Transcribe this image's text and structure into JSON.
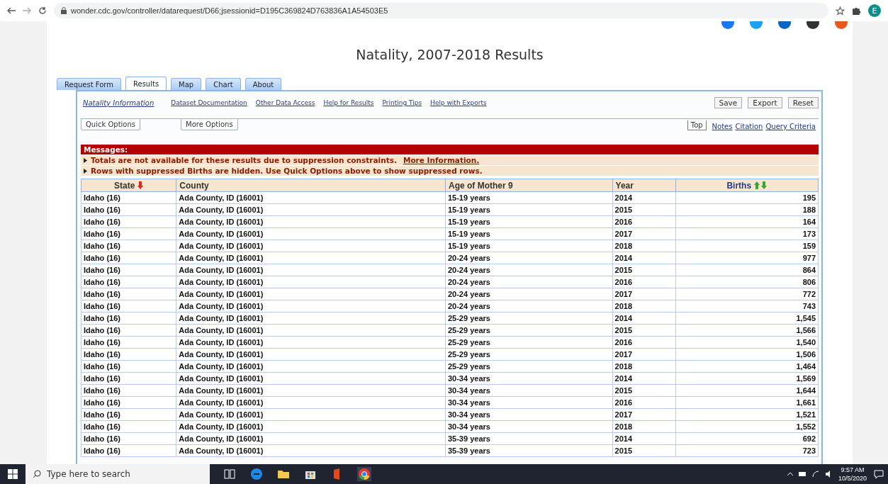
{
  "browser": {
    "url": "wonder.cdc.gov/controller/datarequest/D66;jsessionid=D195C369824D763836A1A54503E5",
    "profile": "E"
  },
  "page": {
    "title": "Natality, 2007-2018 Results",
    "tabs": [
      {
        "label": "Request Form",
        "selected": false
      },
      {
        "label": "Results",
        "selected": true
      },
      {
        "label": "Map",
        "selected": false
      },
      {
        "label": "Chart",
        "selected": false
      },
      {
        "label": "About",
        "selected": false
      }
    ],
    "links": [
      {
        "label": "Natality Information",
        "kind": "italic"
      },
      {
        "label": "Dataset Documentation",
        "kind": "plain"
      },
      {
        "label": "Other Data Access",
        "kind": "plain"
      },
      {
        "label": "Help for Results",
        "kind": "plain"
      },
      {
        "label": "Printing Tips",
        "kind": "plain"
      },
      {
        "label": "Help with Exports",
        "kind": "plain"
      }
    ],
    "buttons": [
      "Save",
      "Export",
      "Reset"
    ],
    "option_tabs": [
      "Quick Options",
      "More Options"
    ],
    "section_links": [
      {
        "label": "Top",
        "kind": "box"
      },
      {
        "label": "Notes",
        "kind": "link"
      },
      {
        "label": "Citation",
        "kind": "link"
      },
      {
        "label": "Query Criteria",
        "kind": "link"
      }
    ],
    "messages": {
      "title": "Messages:",
      "items": [
        {
          "text": "Totals are not available for these results due to suppression constraints.",
          "link": "More Information."
        },
        {
          "text": "Rows with suppressed Births are hidden. Use Quick Options above to show suppressed rows."
        }
      ]
    },
    "table": {
      "columns": [
        {
          "label": "State",
          "kind": "sorted"
        },
        {
          "label": "County",
          "kind": "plain"
        },
        {
          "label": "Age of Mother 9",
          "kind": "plain"
        },
        {
          "label": "Year",
          "kind": "plain"
        },
        {
          "label": "Births",
          "kind": "sortable"
        }
      ],
      "rows": [
        [
          "Idaho (16)",
          "Ada County, ID (16001)",
          "15-19 years",
          "2014",
          "195"
        ],
        [
          "Idaho (16)",
          "Ada County, ID (16001)",
          "15-19 years",
          "2015",
          "188"
        ],
        [
          "Idaho (16)",
          "Ada County, ID (16001)",
          "15-19 years",
          "2016",
          "164"
        ],
        [
          "Idaho (16)",
          "Ada County, ID (16001)",
          "15-19 years",
          "2017",
          "173"
        ],
        [
          "Idaho (16)",
          "Ada County, ID (16001)",
          "15-19 years",
          "2018",
          "159"
        ],
        [
          "Idaho (16)",
          "Ada County, ID (16001)",
          "20-24 years",
          "2014",
          "977"
        ],
        [
          "Idaho (16)",
          "Ada County, ID (16001)",
          "20-24 years",
          "2015",
          "864"
        ],
        [
          "Idaho (16)",
          "Ada County, ID (16001)",
          "20-24 years",
          "2016",
          "806"
        ],
        [
          "Idaho (16)",
          "Ada County, ID (16001)",
          "20-24 years",
          "2017",
          "772"
        ],
        [
          "Idaho (16)",
          "Ada County, ID (16001)",
          "20-24 years",
          "2018",
          "743"
        ],
        [
          "Idaho (16)",
          "Ada County, ID (16001)",
          "25-29 years",
          "2014",
          "1,545"
        ],
        [
          "Idaho (16)",
          "Ada County, ID (16001)",
          "25-29 years",
          "2015",
          "1,566"
        ],
        [
          "Idaho (16)",
          "Ada County, ID (16001)",
          "25-29 years",
          "2016",
          "1,540"
        ],
        [
          "Idaho (16)",
          "Ada County, ID (16001)",
          "25-29 years",
          "2017",
          "1,506"
        ],
        [
          "Idaho (16)",
          "Ada County, ID (16001)",
          "25-29 years",
          "2018",
          "1,464"
        ],
        [
          "Idaho (16)",
          "Ada County, ID (16001)",
          "30-34 years",
          "2014",
          "1,569"
        ],
        [
          "Idaho (16)",
          "Ada County, ID (16001)",
          "30-34 years",
          "2015",
          "1,644"
        ],
        [
          "Idaho (16)",
          "Ada County, ID (16001)",
          "30-34 years",
          "2016",
          "1,661"
        ],
        [
          "Idaho (16)",
          "Ada County, ID (16001)",
          "30-34 years",
          "2017",
          "1,521"
        ],
        [
          "Idaho (16)",
          "Ada County, ID (16001)",
          "30-34 years",
          "2018",
          "1,552"
        ],
        [
          "Idaho (16)",
          "Ada County, ID (16001)",
          "35-39 years",
          "2014",
          "692"
        ],
        [
          "Idaho (16)",
          "Ada County, ID (16001)",
          "35-39 years",
          "2015",
          "723"
        ]
      ]
    }
  },
  "taskbar": {
    "search_placeholder": "Type here to search",
    "time": "9:57 AM",
    "date": "10/5/2020"
  }
}
